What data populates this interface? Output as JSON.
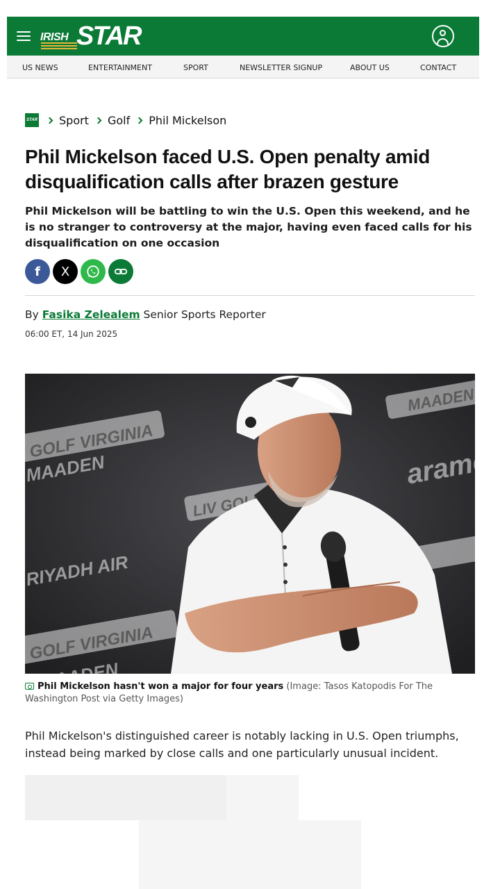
{
  "header": {
    "logo_small": "IRISH",
    "logo_big": "STAR"
  },
  "nav": [
    "US NEWS",
    "ENTERTAINMENT",
    "SPORT",
    "NEWSLETTER SIGNUP",
    "ABOUT US",
    "CONTACT"
  ],
  "breadcrumb": {
    "logo_text": "STAR",
    "items": [
      "Sport",
      "Golf",
      "Phil Mickelson"
    ]
  },
  "article": {
    "headline": "Phil Mickelson faced U.S. Open penalty amid disqualification calls after brazen gesture",
    "standfirst": "Phil Mickelson will be battling to win the U.S. Open this weekend, and he is no stranger to controversy at the major, having even faced calls for his disqualification on one occasion",
    "byline_prefix": "By",
    "author": "Fasika Zelealem",
    "author_role": "Senior Sports Reporter",
    "timestamp": "06:00 ET, 14 Jun 2025",
    "image": {
      "caption": "Phil Mickelson hasn't won a major for four years",
      "credit": "(Image: Tasos Katopodis For The Washington Post via Getty Images)",
      "backdrop_text": [
        "GOLF VIRGINIA",
        "MAADEN",
        "RIYADH AIR",
        "GOLF VIRGINIA",
        "MAADEN",
        "LIV GOLF",
        "MAADEN",
        "aramco"
      ]
    },
    "body": "Phil Mickelson's distinguished career is notably lacking in U.S. Open triumphs, instead being marked by close calls and one particularly unusual incident."
  },
  "share": {
    "facebook": "f",
    "x": "X",
    "whatsapp": "whatsapp-icon",
    "link": "link-icon"
  },
  "colors": {
    "brand_green": "#0b7a36",
    "logo_gold": "#e7b73a",
    "facebook": "#3b5998",
    "whatsapp": "#2fb94a"
  }
}
